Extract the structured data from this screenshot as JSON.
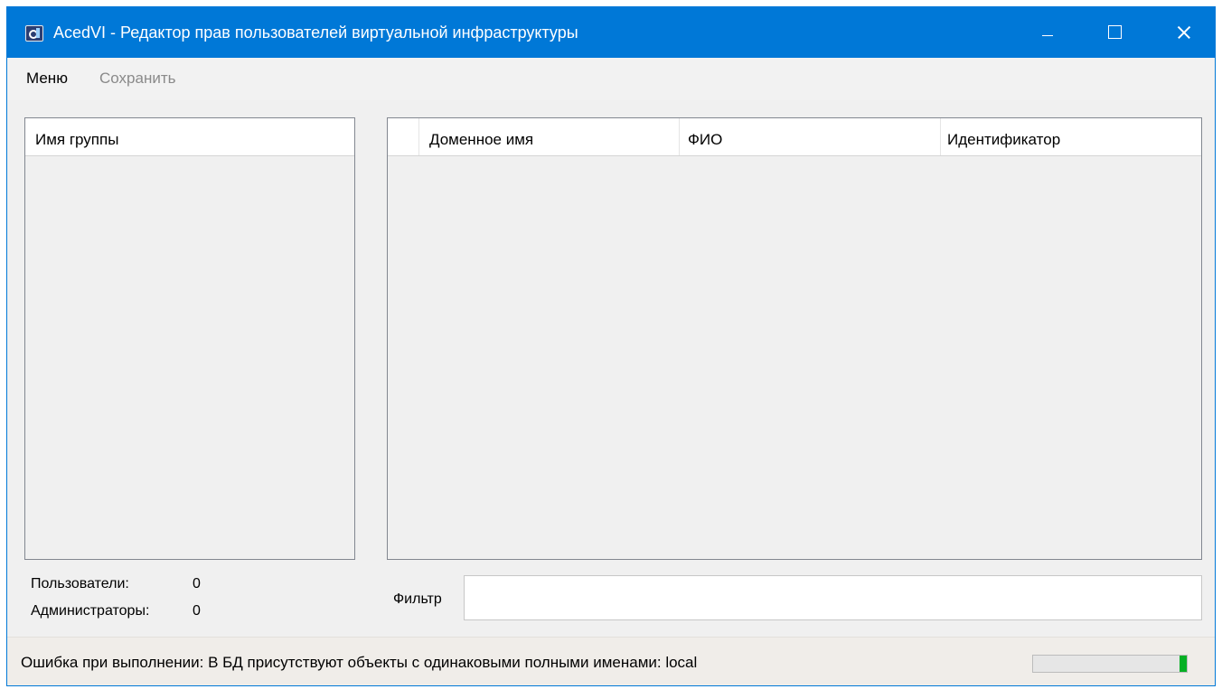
{
  "window": {
    "title": "AcedVI - Редактор прав пользователей виртуальной инфраструктуры",
    "icon": "app-icon"
  },
  "menu": {
    "menu_label": "Меню",
    "save_label": "Сохранить"
  },
  "groups": {
    "columns": [
      "Имя группы"
    ],
    "rows": []
  },
  "users": {
    "columns": [
      "",
      "Доменное имя",
      "ФИО",
      "Идентификатор"
    ],
    "rows": []
  },
  "stats": {
    "users_label": "Пользователи:",
    "users_value": "0",
    "admins_label": "Администраторы:",
    "admins_value": "0"
  },
  "filter": {
    "label": "Фильтр",
    "value": ""
  },
  "status": {
    "text": "Ошибка при выполнении: В БД присутствуют объекты с одинаковыми полными именами: local",
    "progress_fraction": 0.05
  },
  "colors": {
    "titlebar": "#0078d7",
    "progress_fill": "#06b025",
    "disabled_text": "#8a8a8a"
  }
}
